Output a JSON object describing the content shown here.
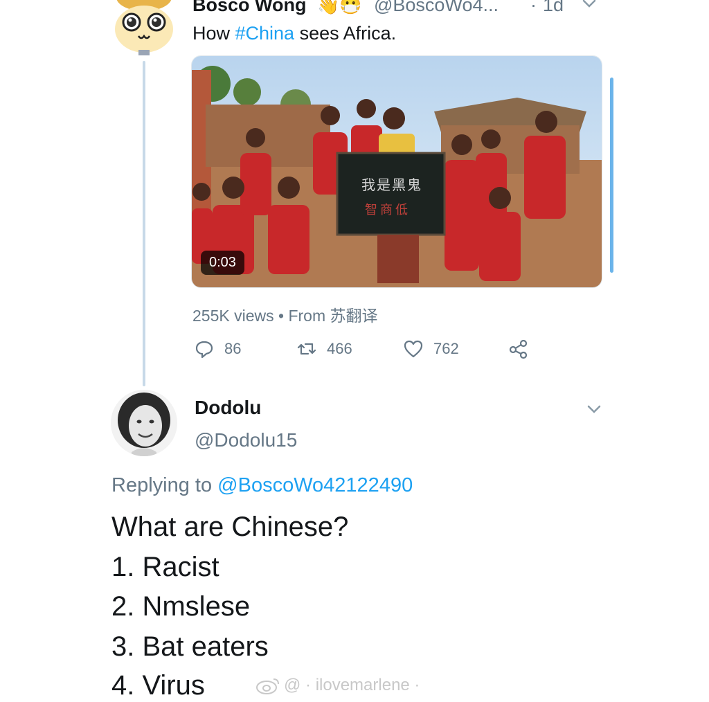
{
  "tweet": {
    "display_name": "Bosco Wong",
    "emoji": "👋😷",
    "handle": "@BoscoWo4...",
    "separator": "·",
    "time": "1d",
    "text_before": "How ",
    "hashtag": "#China",
    "text_after": " sees Africa.",
    "video": {
      "duration": "0:03",
      "board_line1": "我是黑鬼",
      "board_line2": "智商低"
    },
    "views": "255K views",
    "views_separator": "•",
    "source": "From 苏翻译",
    "actions": {
      "replies": "86",
      "retweets": "466",
      "likes": "762"
    }
  },
  "reply": {
    "display_name": "Dodolu",
    "handle": "@Dodolu15",
    "replying_prefix": "Replying to ",
    "replying_mention": "@BoscoWo42122490",
    "lines": [
      "What are Chinese?",
      "1. Racist",
      "2. Nmslese",
      "3. Bat eaters",
      "4. Virus"
    ]
  },
  "watermark": {
    "text": "@ · ilovemarlene ·"
  },
  "colors": {
    "link": "#1da1f2",
    "secondary": "#657786",
    "thread_line": "#c7d9e8"
  }
}
